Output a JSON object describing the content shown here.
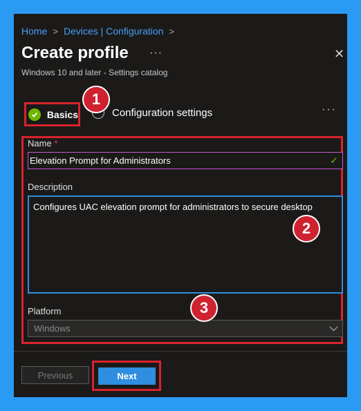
{
  "breadcrumb": {
    "home": "Home",
    "devices": "Devices | Configuration"
  },
  "header": {
    "title": "Create profile",
    "subtitle": "Windows 10 and later - Settings catalog",
    "more": "···",
    "close": "✕"
  },
  "steps": {
    "basics": "Basics",
    "configuration": "Configuration settings",
    "more": "···"
  },
  "badges": [
    "1",
    "2",
    "3"
  ],
  "form": {
    "name_label": "Name",
    "required_mark": "*",
    "name_value": "Elevation Prompt for Administrators",
    "description_label": "Description",
    "description_value": "Configures UAC elevation prompt for administrators to secure desktop",
    "platform_label": "Platform",
    "platform_value": "Windows"
  },
  "footer": {
    "previous": "Previous",
    "next": "Next"
  },
  "colors": {
    "background": "#2b9af3",
    "panel": "#1b1a19",
    "link": "#479ef5",
    "highlight": "#d9232d",
    "primary": "#2f8ee0",
    "success": "#6bb700"
  }
}
